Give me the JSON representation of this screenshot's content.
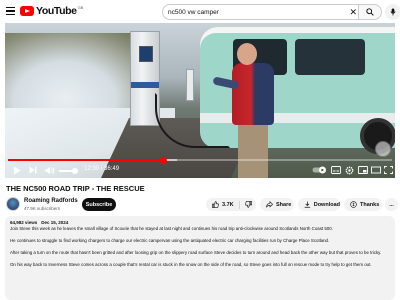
{
  "header": {
    "logo_text": "YouTube",
    "logo_region": "GB",
    "search_query": "nc500 vw camper",
    "icons": [
      "menu-icon",
      "search-icon",
      "mic-icon",
      "close-icon"
    ]
  },
  "player": {
    "current_time": "12:30",
    "duration": "36:49",
    "time_display": "12:30 / 36:49",
    "progress_fraction": 0.405,
    "buffered_fraction": 0.44,
    "volume_fraction": 0.9,
    "accent_color": "#ff0000",
    "controls": [
      "play-icon",
      "next-icon",
      "volume-icon",
      "autoplay-toggle",
      "captions-icon",
      "settings-icon",
      "miniplayer-icon",
      "theater-icon",
      "fullscreen-icon"
    ]
  },
  "video": {
    "title": "THE NC500 ROAD TRIP - THE RESCUE"
  },
  "channel": {
    "name": "Roaming Radfords",
    "subscribers": "47.9K subscribers",
    "subscribe_label": "Subscribe"
  },
  "actions": {
    "like_count": "3.7K",
    "share_label": "Share",
    "download_label": "Download",
    "thanks_label": "Thanks",
    "more_label": "..."
  },
  "description": {
    "views": "64,982 views",
    "date": "Dec 15, 2024",
    "paragraphs": [
      "Join Steve this week as he leaves the small village of Scourie that he stayed at last night and continues his road trip anti-clockwise around Scotlands North Coast 500.",
      "He continues to struggle to find working chargers to charge our electric campervan using the antiquated electric car charging facilities run by Charge Place Scotland.",
      "After taking a turn on the route that hasn't been gritted and after loosing grip on the slippery road surface Steve decides to turn around and head back the other way but that proves to be tricky.",
      "On his way back to Inverness Steve comes across a couple that's rental car is stuck in the snow on the side of the road, so Steve goes into full on rescue mode to try help to get them out."
    ]
  }
}
